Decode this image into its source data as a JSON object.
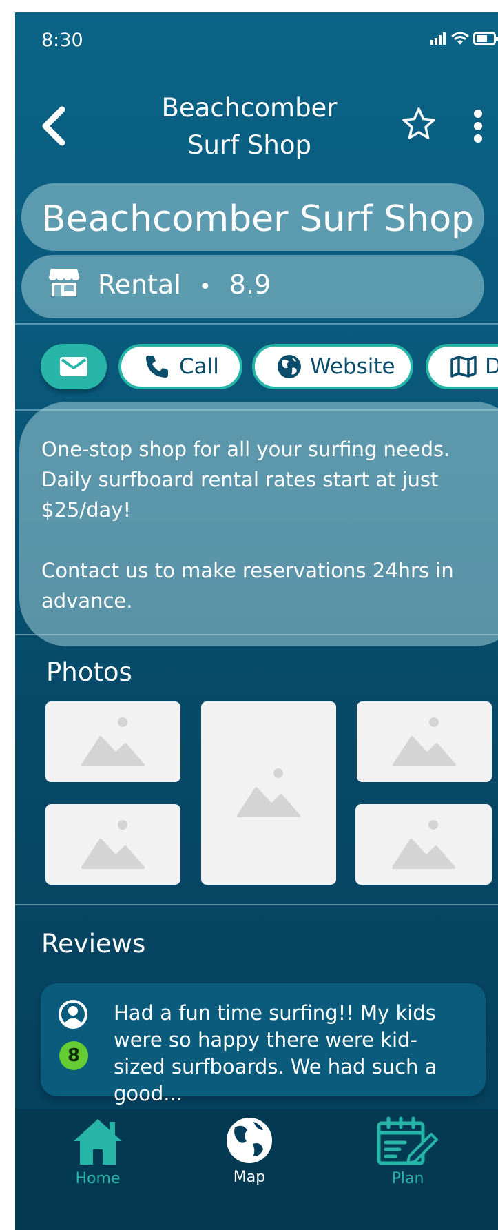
{
  "status_bar": {
    "time": "8:30"
  },
  "nav": {
    "title": "Beachcomber Surf Shop",
    "back_icon": "chevron-left-icon",
    "favorite_icon": "star-outline-icon",
    "more_icon": "more-vertical-icon"
  },
  "place": {
    "name": "Beachcomber Surf Shop",
    "category": "Rental",
    "separator": "•",
    "rating": "8.9",
    "category_icon": "storefront-icon"
  },
  "actions": {
    "email_icon": "envelope-icon",
    "call_label": "Call",
    "website_label": "Website",
    "directions_label": "Directions"
  },
  "description": {
    "paragraph1": "One-stop shop for all your surfing needs. Daily surfboard rental rates start at just $25/day!",
    "paragraph2": "Contact us to make reservations 24hrs in advance."
  },
  "photos": {
    "title": "Photos",
    "count": 5
  },
  "reviews": {
    "title": "Reviews",
    "items": [
      {
        "score": "8",
        "text": "Had a fun time surfing!! My kids were so happy there were kid-sized surfboards. We had such a good..."
      }
    ]
  },
  "tabbar": {
    "items": [
      {
        "label": "Home",
        "icon": "home-icon",
        "color": "#27b5a8"
      },
      {
        "label": "Map",
        "icon": "globe-icon",
        "color": "#ffffff"
      },
      {
        "label": "Plan",
        "icon": "calendar-edit-icon",
        "color": "#27b5a8"
      }
    ]
  },
  "colors": {
    "accent": "#27b5a8",
    "background_top": "#0b6487",
    "background_bottom": "#053e5a",
    "score_badge": "#66cc33"
  }
}
